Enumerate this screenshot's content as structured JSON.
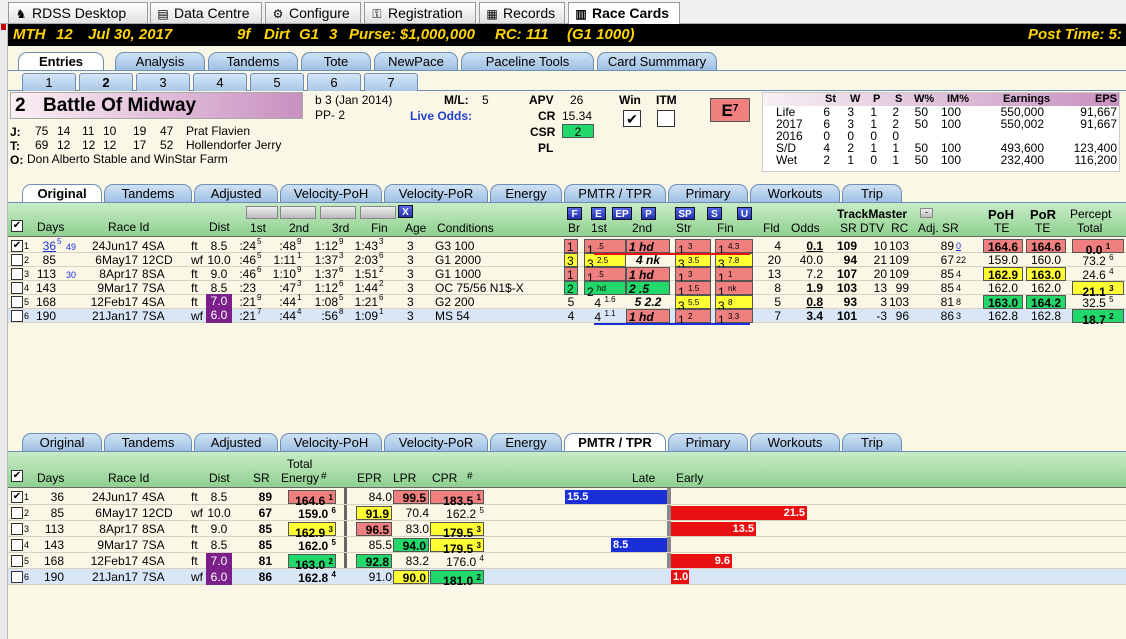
{
  "top_tabs": [
    {
      "label": "RDSS Desktop",
      "icon": "horse-icon"
    },
    {
      "label": "Data Centre",
      "icon": "folder-icon"
    },
    {
      "label": "Configure",
      "icon": "gear-icon"
    },
    {
      "label": "Registration",
      "icon": "key-icon"
    },
    {
      "label": "Records",
      "icon": "grid-icon"
    },
    {
      "label": "Race Cards",
      "icon": "book-icon"
    }
  ],
  "race": {
    "track": "MTH",
    "num": "12",
    "date": "Jul 30, 2017",
    "dist": "9f",
    "surface": "Dirt",
    "grade": "G1",
    "field": "3",
    "purse": "Purse: $1,000,000",
    "rc": "RC: 111",
    "rc_grade": "(G1 1000)",
    "post": "Post Time: 5:"
  },
  "main_tabs": [
    "Entries",
    "Analysis",
    "Tandems",
    "Tote",
    "NewPace",
    "Paceline Tools",
    "Card Summmary"
  ],
  "entry_tabs": [
    "1",
    "2",
    "3",
    "4",
    "5",
    "6",
    "7"
  ],
  "horse": {
    "num": "2",
    "name": "Battle Of Midway",
    "age": "b 3 (Jan 2014)",
    "pp": "PP- 2",
    "ml_label": "M/L:",
    "ml": "5",
    "live_odds": "Live Odds:",
    "apv_l": "APV",
    "apv": "26",
    "cr_l": "CR",
    "cr": "15.34",
    "csr_l": "CSR",
    "csr": "2",
    "pl_l": "PL",
    "win_l": "Win",
    "itm_l": "ITM",
    "e_label": "E",
    "e_num": "7",
    "j_l": "J:",
    "j_stats": [
      "75",
      "14",
      "11",
      "10",
      "19",
      "47"
    ],
    "jockey": "Prat Flavien",
    "t_l": "T:",
    "t_stats": [
      "69",
      "12",
      "12",
      "12",
      "17",
      "52"
    ],
    "trainer": "Hollendorfer Jerry",
    "o_l": "O:",
    "owner": "Don Alberto Stable and WinStar Farm"
  },
  "record": {
    "headers": [
      "St",
      "W",
      "P",
      "S",
      "W%",
      "IM%",
      "Earnings",
      "EPS"
    ],
    "rows": [
      {
        "l": "Life",
        "v": [
          "6",
          "3",
          "1",
          "2",
          "50",
          "100",
          "550,000",
          "91,667"
        ]
      },
      {
        "l": "2017",
        "v": [
          "6",
          "3",
          "1",
          "2",
          "50",
          "100",
          "550,002",
          "91,667"
        ]
      },
      {
        "l": "2016",
        "v": [
          "0",
          "0",
          "0",
          "0",
          "",
          "",
          "",
          ""
        ]
      },
      {
        "l": "S/D",
        "v": [
          "4",
          "2",
          "1",
          "1",
          "50",
          "100",
          "493,600",
          "123,400"
        ]
      },
      {
        "l": "Wet",
        "v": [
          "2",
          "1",
          "0",
          "1",
          "50",
          "100",
          "232,400",
          "116,200"
        ]
      }
    ]
  },
  "sub_tabs": [
    "Original",
    "Tandems",
    "Adjusted",
    "Velocity-PoH",
    "Velocity-PoR",
    "Energy",
    "PMTR / TPR",
    "Primary",
    "Workouts",
    "Trip"
  ],
  "t1": {
    "headers": {
      "days": "Days",
      "raceid": "Race Id",
      "dist": "Dist",
      "c1": "1st",
      "c2": "2nd",
      "c3": "3rd",
      "fin": "Fin",
      "age": "Age",
      "cond": "Conditions",
      "br": "Br",
      "p1": "1st",
      "p2": "2nd",
      "str": "Str",
      "pfin": "Fin",
      "fld": "Fld",
      "odds": "Odds",
      "tm": "TrackMaster",
      "sr": "SR",
      "dtv": "DTV",
      "rc": "RC",
      "adj": "Adj. SR",
      "poh": "PoH",
      "poh2": "TE",
      "por": "PoR",
      "por2": "TE",
      "pct": "Percept",
      "pct2": "Total"
    },
    "btns": [
      "F",
      "E",
      "EP",
      "P",
      "SP",
      "S",
      "U",
      "X",
      "-"
    ],
    "rows": [
      {
        "n": "1",
        "chk": true,
        "days": "36",
        "dsup": "5",
        "dx": "49",
        "date": "24Jun17",
        "trk": "4SA",
        "sfc": "ft",
        "dist": "8.5",
        "q1": ":24",
        "q1s": "5",
        "q2": ":48",
        "q2s": "9",
        "q3": "1:12",
        "q3s": "9",
        "fin": "1:43",
        "fins": "3",
        "age": "3",
        "cond": "G3 100",
        "br": "1",
        "p1": "1",
        "p1s": ".5",
        "p2": "1 hd",
        "st": "1",
        "sts": "3",
        "pf": "1",
        "pfs": "4.3",
        "fld": "4",
        "odds": "0.1",
        "sr": "109",
        "dtv": "10",
        "rc": "103",
        "adj": "89",
        "adjs": "0",
        "poh": "164.6",
        "por": "164.6",
        "pct": "0.0",
        "pcts": "1"
      },
      {
        "n": "2",
        "chk": false,
        "days": "85",
        "dsup": "",
        "dx": "",
        "date": "6May17",
        "trk": "12CD",
        "sfc": "wf",
        "dist": "10.0",
        "q1": ":46",
        "q1s": "5",
        "q2": "1:11",
        "q2s": "1",
        "q3": "1:37",
        "q3s": "3",
        "fin": "2:03",
        "fins": "6",
        "age": "3",
        "cond": "G1 2000",
        "br": "3",
        "p1": "3",
        "p1s": "2.5",
        "p2": "4 nk",
        "st": "3",
        "sts": "3.5",
        "pf": "3",
        "pfs": "7.8",
        "fld": "20",
        "odds": "40.0",
        "sr": "94",
        "dtv": "21",
        "rc": "109",
        "adj": "67",
        "adjs": "22",
        "poh": "159.0",
        "por": "160.0",
        "pct": "73.2",
        "pcts": "6"
      },
      {
        "n": "3",
        "chk": false,
        "days": "113",
        "dsup": "",
        "dx": "30",
        "date": "8Apr17",
        "trk": "8SA",
        "sfc": "ft",
        "dist": "9.0",
        "q1": ":46",
        "q1s": "6",
        "q2": "1:10",
        "q2s": "9",
        "q3": "1:37",
        "q3s": "6",
        "fin": "1:51",
        "fins": "2",
        "age": "3",
        "cond": "G1 1000",
        "br": "1",
        "p1": "1",
        "p1s": ".5",
        "p2": "1 hd",
        "st": "1",
        "sts": "3",
        "pf": "1",
        "pfs": "1",
        "fld": "13",
        "odds": "7.2",
        "sr": "107",
        "dtv": "20",
        "rc": "109",
        "adj": "85",
        "adjs": "4",
        "poh": "162.9",
        "por": "163.0",
        "pct": "24.6",
        "pcts": "4"
      },
      {
        "n": "4",
        "chk": false,
        "days": "143",
        "dsup": "",
        "dx": "",
        "date": "9Mar17",
        "trk": "7SA",
        "sfc": "ft",
        "dist": "8.5",
        "q1": ":23",
        "q1s": "",
        "q2": ":47",
        "q2s": "3",
        "q3": "1:12",
        "q3s": "6",
        "fin": "1:44",
        "fins": "2",
        "age": "3",
        "cond": "OC 75/56 N1$-X",
        "br": "2",
        "p1": "2",
        "p1s": "hd",
        "p2": "2 .5",
        "st": "1",
        "sts": "1.5",
        "pf": "1",
        "pfs": "nk",
        "fld": "8",
        "odds": "1.9",
        "sr": "103",
        "dtv": "13",
        "rc": "99",
        "adj": "85",
        "adjs": "4",
        "poh": "162.0",
        "por": "162.0",
        "pct": "21.1",
        "pcts": "3"
      },
      {
        "n": "5",
        "chk": false,
        "days": "168",
        "dsup": "",
        "dx": "",
        "date": "12Feb17",
        "trk": "4SA",
        "sfc": "ft",
        "dist": "7.0",
        "q1": ":21",
        "q1s": "9",
        "q2": ":44",
        "q2s": "1",
        "q3": "1:08",
        "q3s": "5",
        "fin": "1:21",
        "fins": "6",
        "age": "3",
        "cond": "G2 200",
        "br": "5",
        "p1": "4",
        "p1s": "1.6",
        "p2": "5 2.2",
        "st": "3",
        "sts": "5.5",
        "pf": "3",
        "pfs": "8",
        "fld": "5",
        "odds": "0.8",
        "sr": "93",
        "dtv": "3",
        "rc": "103",
        "adj": "81",
        "adjs": "8",
        "poh": "163.0",
        "por": "164.2",
        "pct": "32.5",
        "pcts": "5"
      },
      {
        "n": "6",
        "chk": false,
        "days": "190",
        "dsup": "",
        "dx": "",
        "date": "21Jan17",
        "trk": "7SA",
        "sfc": "wf",
        "dist": "6.0",
        "q1": ":21",
        "q1s": "7",
        "q2": ":44",
        "q2s": "4",
        "q3": ":56",
        "q3s": "8",
        "fin": "1:09",
        "fins": "1",
        "age": "3",
        "cond": "MS 54",
        "br": "4",
        "p1": "4",
        "p1s": "1.1",
        "p2": "1 hd",
        "st": "1",
        "sts": "2",
        "pf": "1",
        "pfs": "3.3",
        "fld": "7",
        "odds": "3.4",
        "sr": "101",
        "dtv": "-3",
        "rc": "96",
        "adj": "86",
        "adjs": "3",
        "poh": "162.8",
        "por": "162.8",
        "pct": "18.7",
        "pcts": "2"
      }
    ]
  },
  "t2": {
    "headers": {
      "days": "Days",
      "raceid": "Race Id",
      "dist": "Dist",
      "sr": "SR",
      "te1": "Total",
      "te2": "Energy",
      "hash": "#",
      "epr": "EPR",
      "lpr": "LPR",
      "cpr": "CPR",
      "hash2": "#",
      "late": "Late",
      "early": "Early"
    },
    "rows": [
      {
        "n": "1",
        "chk": true,
        "days": "36",
        "date": "24Jun17",
        "trk": "4SA",
        "sfc": "ft",
        "dist": "8.5",
        "sr": "89",
        "te": "164.6",
        "tes": "1",
        "epr": "84.0",
        "lpr": "99.5",
        "cpr": "183.5",
        "cprs": "1",
        "late": "15.5",
        "early": ""
      },
      {
        "n": "2",
        "chk": false,
        "days": "85",
        "date": "6May17",
        "trk": "12CD",
        "sfc": "wf",
        "dist": "10.0",
        "sr": "67",
        "te": "159.0",
        "tes": "6",
        "epr": "91.9",
        "lpr": "70.4",
        "cpr": "162.2",
        "cprs": "5",
        "late": "",
        "early": "21.5"
      },
      {
        "n": "3",
        "chk": false,
        "days": "113",
        "date": "8Apr17",
        "trk": "8SA",
        "sfc": "ft",
        "dist": "9.0",
        "sr": "85",
        "te": "162.9",
        "tes": "3",
        "epr": "96.5",
        "lpr": "83.0",
        "cpr": "179.5",
        "cprs": "3",
        "late": "",
        "early": "13.5"
      },
      {
        "n": "4",
        "chk": false,
        "days": "143",
        "date": "9Mar17",
        "trk": "7SA",
        "sfc": "ft",
        "dist": "8.5",
        "sr": "85",
        "te": "162.0",
        "tes": "5",
        "epr": "85.5",
        "lpr": "94.0",
        "cpr": "179.5",
        "cprs": "3",
        "late": "8.5",
        "early": ""
      },
      {
        "n": "5",
        "chk": false,
        "days": "168",
        "date": "12Feb17",
        "trk": "4SA",
        "sfc": "ft",
        "dist": "7.0",
        "sr": "81",
        "te": "163.0",
        "tes": "2",
        "epr": "92.8",
        "lpr": "83.2",
        "cpr": "176.0",
        "cprs": "4",
        "late": "",
        "early": "9.6"
      },
      {
        "n": "6",
        "chk": false,
        "days": "190",
        "date": "21Jan17",
        "trk": "7SA",
        "sfc": "wf",
        "dist": "6.0",
        "sr": "86",
        "te": "162.8",
        "tes": "4",
        "epr": "91.0",
        "lpr": "90.0",
        "cpr": "181.0",
        "cprs": "2",
        "late": "",
        "early": "1.0"
      }
    ]
  },
  "colors": {
    "pink": "#f08080",
    "yellow": "#ffff33",
    "green": "#22d86a",
    "purple": "#7b1f8a",
    "blue": "#1a2fd6",
    "red": "#e81010"
  }
}
